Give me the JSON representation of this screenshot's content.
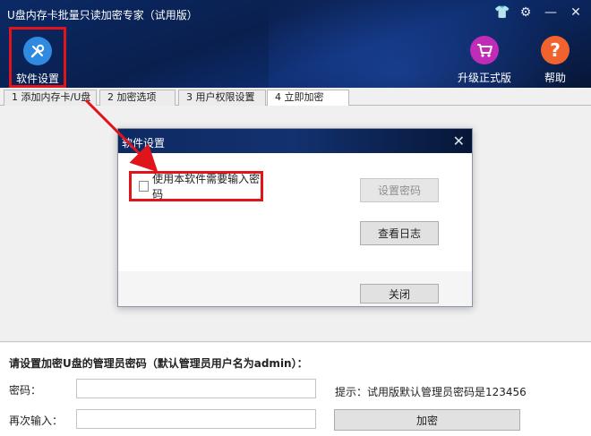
{
  "window": {
    "title": "U盘内存卡批量只读加密专家（试用版）",
    "controls": [
      "shirt-icon",
      "gear-icon",
      "minimize-icon",
      "close-icon"
    ]
  },
  "toolbar": {
    "settings_label": "软件设置",
    "upgrade_label": "升级正式版",
    "help_label": "帮助"
  },
  "tabs": [
    {
      "label": "1 添加内存卡/U盘",
      "active": false
    },
    {
      "label": "2 加密选项",
      "active": false
    },
    {
      "label": "3 用户权限设置",
      "active": false
    },
    {
      "label": "4 立即加密",
      "active": true
    }
  ],
  "dialog": {
    "title": "软件设置",
    "checkbox_label": "使用本软件需要输入密码",
    "checkbox_checked": false,
    "set_password_label": "设置密码",
    "view_log_label": "查看日志",
    "close_label": "关闭"
  },
  "form": {
    "title": "请设置加密U盘的管理员密码（默认管理员用户名为admin）：",
    "password_label": "密码：",
    "confirm_label": "再次输入：",
    "password_value": "",
    "confirm_value": "",
    "hint": "提示：试用版默认管理员密码是123456",
    "encrypt_label": "加密"
  },
  "colors": {
    "header_bg": "#0a1f4e",
    "highlight_red": "#e0141b",
    "settings_icon": "#2f8ae0",
    "upgrade_icon": "#c02bb8",
    "help_icon": "#f0622e"
  }
}
